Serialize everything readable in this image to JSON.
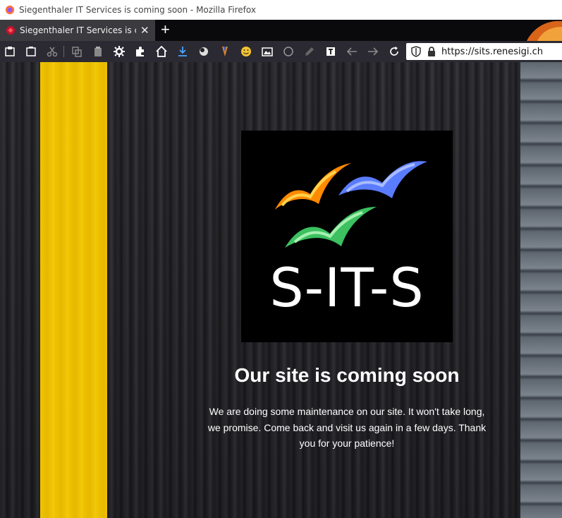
{
  "window": {
    "title": "Siegenthaler IT Services is coming soon - Mozilla Firefox"
  },
  "tabs": [
    {
      "title": "Siegenthaler IT Services is coming soon",
      "active": true
    }
  ],
  "toolbar": {
    "icons": [
      "save-page-icon",
      "save-as-icon",
      "cut-icon",
      "copy-icon",
      "clipboard-icon",
      "settings-gear-icon",
      "addons-puzzle-icon",
      "home-icon",
      "downloads-icon",
      "extension-ball-icon",
      "extension-pen-icon",
      "emoji-icon",
      "screenshot-icon",
      "circle-icon",
      "pencil-icon",
      "reader-icon",
      "back-arrow-icon",
      "forward-arrow-icon",
      "reload-icon"
    ],
    "url": "https://sits.renesigi.ch"
  },
  "page": {
    "logo_text": "S-IT-S",
    "headline": "Our site is coming soon",
    "message": "We are doing some maintenance on our site. It won't take long, we promise. Come back and visit us again in a few days. Thank you for your patience!"
  },
  "colors": {
    "tab_active": "#3b3b3f",
    "toolbar": "#2b2a33",
    "stripe_yellow": "#f0c400",
    "bird_orange": "#ff8a00",
    "bird_blue": "#5a7cff",
    "bird_green": "#3cc060"
  }
}
